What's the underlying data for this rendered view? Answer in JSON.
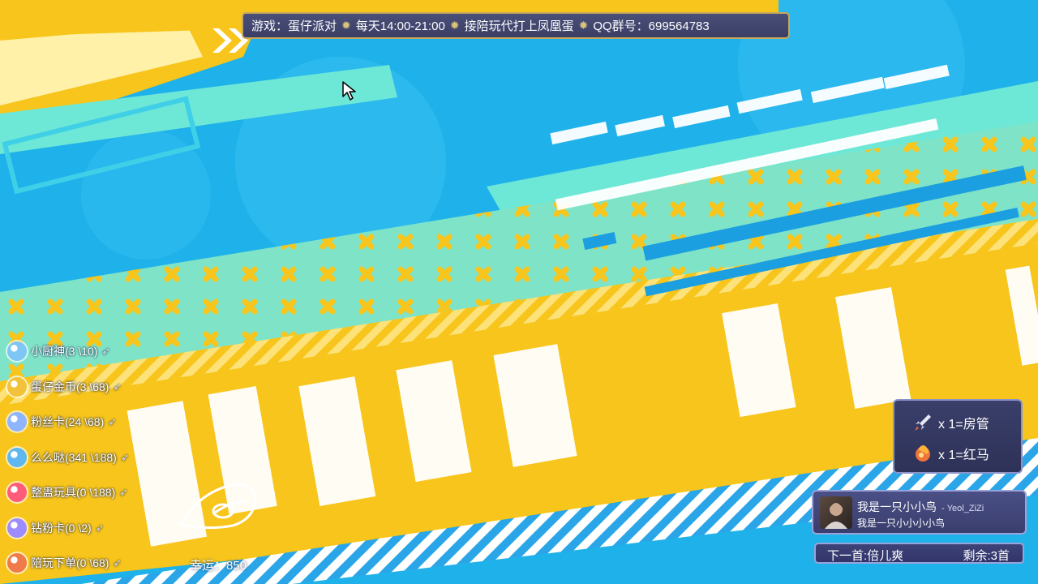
{
  "banner": {
    "game": "游戏：蛋仔派对",
    "time": "每天14:00-21:00",
    "service": "接陪玩代打上凤凰蛋",
    "qq": "QQ群号：699564783"
  },
  "gifts": [
    {
      "label": "小厨神(3 \\10)",
      "icon": "chef-icon",
      "color": "#7ec6f5"
    },
    {
      "label": "蛋仔金币(3 \\68)",
      "icon": "coin-icon",
      "color": "#f2c23a"
    },
    {
      "label": "粉丝卡(24 \\68)",
      "icon": "fan-card-icon",
      "color": "#8fb5ff"
    },
    {
      "label": "么么哒(341 \\188)",
      "icon": "kiss-icon",
      "color": "#5fb7f0"
    },
    {
      "label": "整蛊玩具(0 \\188)",
      "icon": "prank-toy-icon",
      "color": "#ff5c7a"
    },
    {
      "label": "钻粉卡(0 \\2)",
      "icon": "diamond-card-icon",
      "color": "#9d8cff"
    },
    {
      "label": "陪玩下单(0 \\68)",
      "icon": "order-icon",
      "color": "#f07a4a"
    }
  ],
  "lucky": {
    "label": "幸运：850"
  },
  "admin": {
    "rows": [
      {
        "label": "x 1=房管",
        "icon": "rocket-icon"
      },
      {
        "label": "x 1=红马",
        "icon": "fire-ball-icon"
      }
    ]
  },
  "song": {
    "title": "我是一只小小鸟",
    "artist": "- Yeol_ZiZi",
    "requester": "我是一只小小小小鸟",
    "next": "下一首:倍儿爽",
    "remaining": "剩余:3首"
  },
  "colors": {
    "sky": "#1fb2ea",
    "yellow": "#f7c51b",
    "mint": "#6ee8d6",
    "panel": "#3a3f6a",
    "gold_border": "#c8a85a"
  }
}
